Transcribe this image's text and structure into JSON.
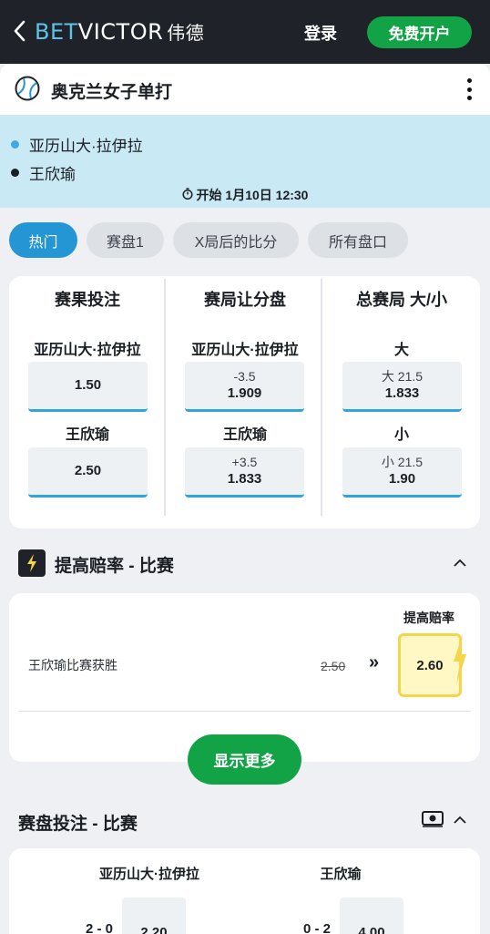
{
  "header": {
    "logo_bet": "BET",
    "logo_victor": "VICTOR",
    "logo_cn": "伟德",
    "login": "登录",
    "signup": "免费开户"
  },
  "event": {
    "title": "奥克兰女子单打",
    "player1": "亚历山大·拉伊拉",
    "player2": "王欣瑜",
    "start": "开始 1月10日 12:30"
  },
  "tabs": [
    "热门",
    "赛盘1",
    "X局后的比分",
    "所有盘口"
  ],
  "markets": {
    "winner": {
      "title": "赛果投注",
      "p1_label": "亚历山大·拉伊拉",
      "p1_odd": "1.50",
      "p2_label": "王欣瑜",
      "p2_odd": "2.50"
    },
    "handicap": {
      "title": "赛局让分盘",
      "p1_label": "亚历山大·拉伊拉",
      "p1_line": "-3.5",
      "p1_odd": "1.909",
      "p2_label": "王欣瑜",
      "p2_line": "+3.5",
      "p2_odd": "1.833"
    },
    "total": {
      "title": "总赛局 大/小",
      "over_label": "大",
      "over_line": "大 21.5",
      "over_odd": "1.833",
      "under_label": "小",
      "under_line": "小 21.5",
      "under_odd": "1.90"
    }
  },
  "boost": {
    "section_title": "提高赔率 - 比赛",
    "label": "提高赔率",
    "selection": "王欣瑜比赛获胜",
    "old_odd": "2.50",
    "arrows": "»",
    "new_odd": "2.60",
    "show_more": "显示更多"
  },
  "correct_score": {
    "section_title": "赛盘投注 - 比赛",
    "player1": "亚历山大·拉伊拉",
    "player2": "王欣瑜",
    "p1_score": "2 - 0",
    "p1_odd": "2.20",
    "p2_score": "0 - 2",
    "p2_odd": "4.00"
  },
  "colors": {
    "header_bg": "#1f2329",
    "brand_green": "#12a346",
    "accent_blue": "#2496d4",
    "player_band": "#c9e9f5",
    "boost_yellow": "#f5d64b"
  }
}
